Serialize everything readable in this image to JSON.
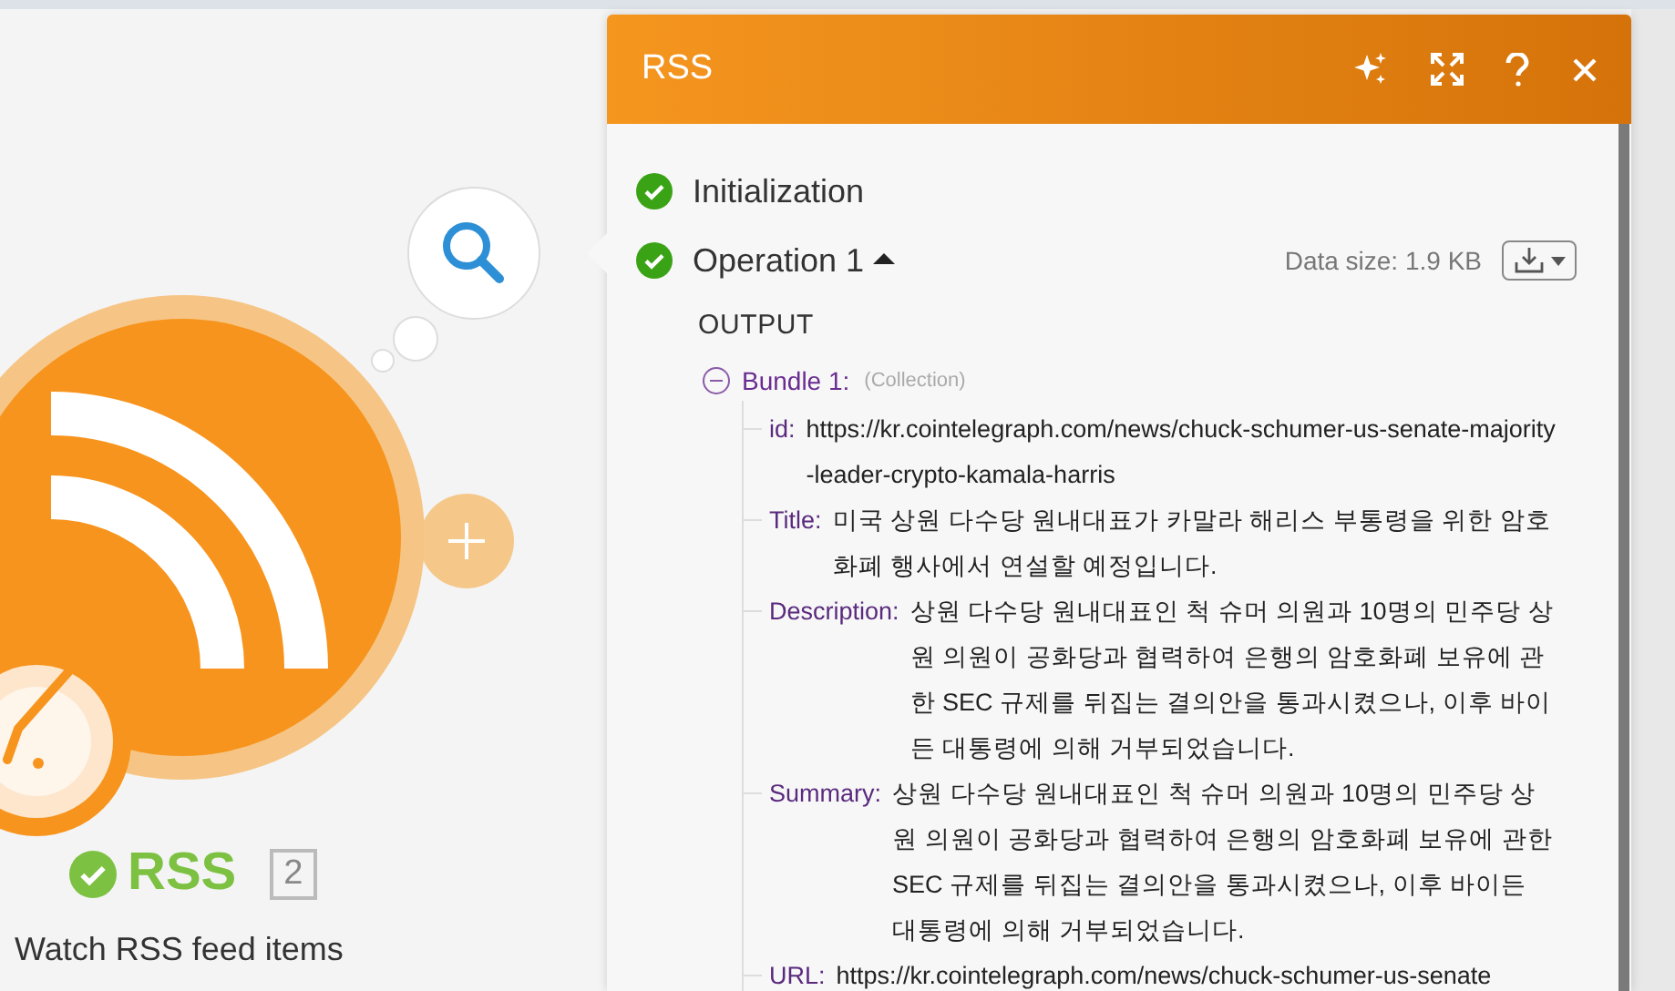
{
  "module": {
    "name": "RSS",
    "completed": true,
    "count": "2",
    "description": "Watch RSS feed items"
  },
  "panel": {
    "title": "RSS",
    "steps": [
      {
        "label": "Initialization",
        "completed": true
      },
      {
        "label": "Operation 1",
        "completed": true,
        "expanded": true,
        "data_size": "Data size: 1.9 KB"
      }
    ],
    "output_heading": "OUTPUT",
    "bundle": {
      "label": "Bundle 1:",
      "type": "(Collection)",
      "expanded": true,
      "fields": [
        {
          "key": "id:",
          "value": "https://kr.cointelegraph.com/news/chuck-schumer-us-senate-majority-leader-crypto-kamala-harris"
        },
        {
          "key": "Title:",
          "value": "미국 상원 다수당 원내대표가 카말라 해리스 부통령을 위한 암호화폐 행사에서 연설할 예정입니다."
        },
        {
          "key": "Description:",
          "value": "상원 다수당 원내대표인 척 슈머 의원과 10명의 민주당 상원 의원이 공화당과 협력하여 은행의 암호화폐 보유에 관한 SEC 규제를 뒤집는 결의안을 통과시켰으나, 이후 바이든 대통령에 의해 거부되었습니다."
        },
        {
          "key": "Summary:",
          "value": "상원 다수당 원내대표인 척 슈머 의원과 10명의 민주당 상원 의원이 공화당과 협력하여 은행의 암호화폐 보유에 관한 SEC 규제를 뒤집는 결의안을 통과시켰으나, 이후 바이든 대통령에 의해 거부되었습니다."
        },
        {
          "key": "URL:",
          "value": "https://kr.cointelegraph.com/news/chuck-schumer-us-senate"
        }
      ]
    }
  }
}
